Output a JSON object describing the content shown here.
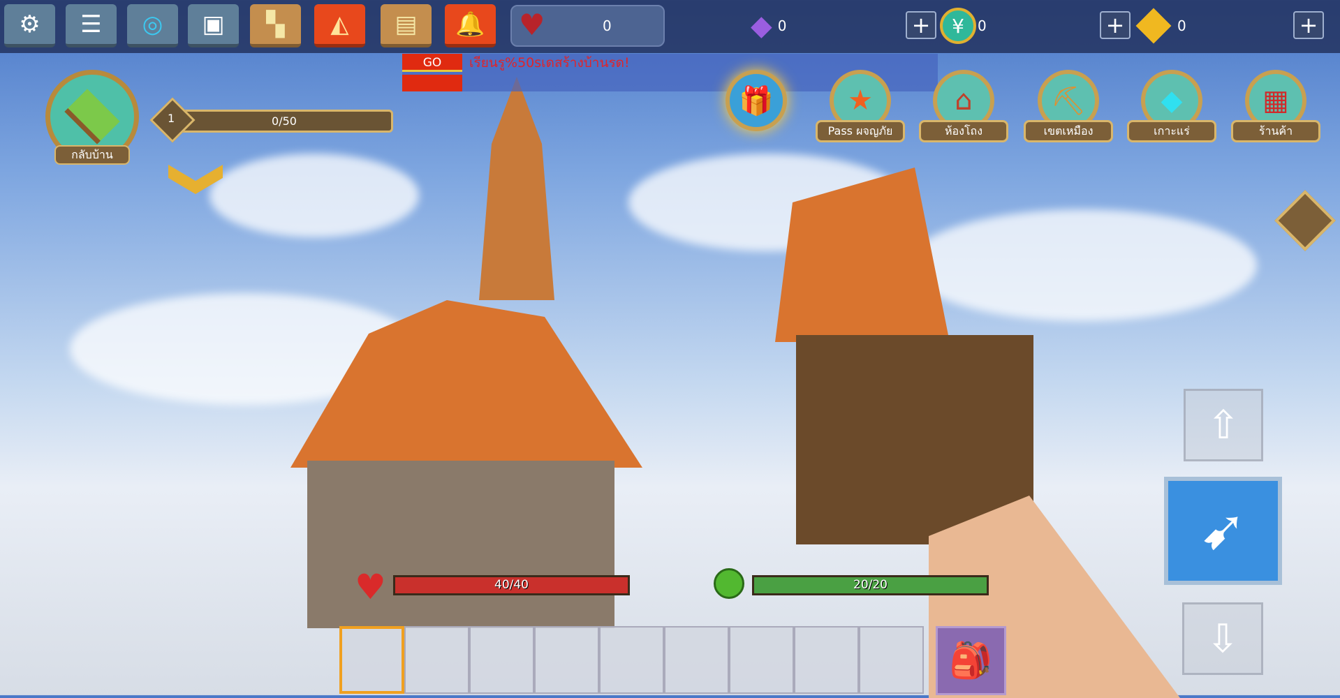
{
  "topbar": {
    "buttons": [
      {
        "name": "settings",
        "icon": "gear-icon"
      },
      {
        "name": "chat",
        "icon": "chat-bubble-icon"
      },
      {
        "name": "target",
        "icon": "crosshair-icon"
      },
      {
        "name": "emote",
        "icon": "face-card-icon"
      },
      {
        "name": "friends",
        "icon": "people-icon"
      },
      {
        "name": "party",
        "icon": "party-popper-icon"
      },
      {
        "name": "tasks",
        "icon": "document-icon"
      },
      {
        "name": "alarm",
        "icon": "bell-icon"
      }
    ],
    "hearts": "0",
    "currencies": [
      {
        "icon": "purple-gem-icon",
        "value": "0"
      },
      {
        "icon": "yuan-coin-icon",
        "value": "0"
      },
      {
        "icon": "gold-cube-icon",
        "value": "0"
      }
    ],
    "plus_label": "+"
  },
  "banner": {
    "go_label": "GO",
    "text": "เรียนรู%50sเดสร้างบ้านรด!"
  },
  "home": {
    "label": "กลับบ้าน"
  },
  "level": {
    "value": "1",
    "xp": "0/50",
    "xp_fraction": 0
  },
  "events": [
    {
      "icon": "gift-box-icon",
      "label": ""
    },
    {
      "icon": "star-badge-icon",
      "label": "Pass ผจญภัย"
    },
    {
      "icon": "hall-icon",
      "label": "ห้องโถง"
    },
    {
      "icon": "pickaxe-mine-icon",
      "label": "เขตเหมือง"
    },
    {
      "icon": "diamond-island-icon",
      "label": "เกาะแร่"
    },
    {
      "icon": "shop-icon",
      "label": "ร้านค้า"
    }
  ],
  "status": {
    "health": "40/40",
    "health_fraction": 1,
    "hunger": "20/20",
    "hunger_fraction": 1
  },
  "hotbar": {
    "slots": 9,
    "selected": 0
  },
  "colors": {
    "health": "#c9302c",
    "hunger": "#4aa043",
    "selected_slot": "#f0a020"
  }
}
